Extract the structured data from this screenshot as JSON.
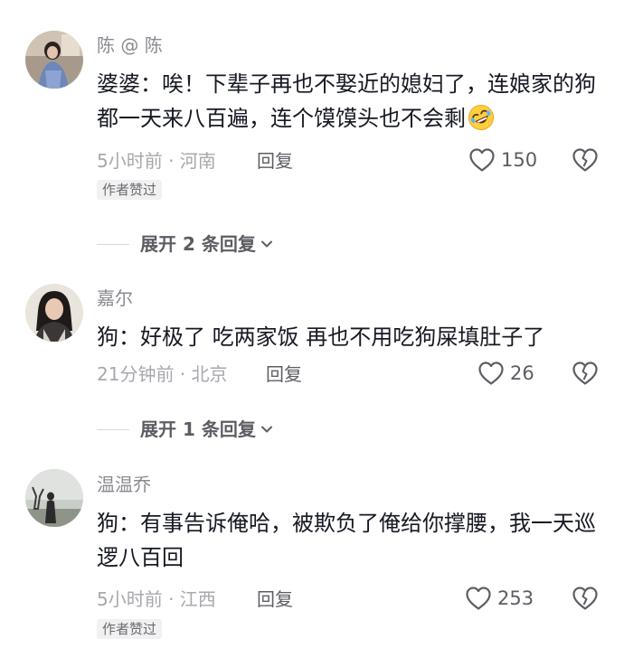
{
  "comments": [
    {
      "username": "陈 @ 陈",
      "text": "婆婆：唉！下辈子再也不娶近的媳妇了，连娘家的狗都一天来八百遍，连个馍馍头也不会剩",
      "emoji": "rolling-on-floor-laughing-emoji",
      "time_location": "5小时前 · 河南",
      "reply_label": "回复",
      "likes": "150",
      "badge": "作者赞过",
      "expand_label": "展开 2 条回复"
    },
    {
      "username": "嘉尔",
      "text": "狗：好极了 吃两家饭 再也不用吃狗屎填肚子了",
      "time_location": "21分钟前 · 北京",
      "reply_label": "回复",
      "likes": "26",
      "expand_label": "展开 1 条回复"
    },
    {
      "username": "温温乔",
      "text": "狗：有事告诉俺哈，被欺负了俺给你撑腰，我一天巡逻八百回",
      "time_location": "5小时前 · 江西",
      "reply_label": "回复",
      "likes": "253",
      "badge": "作者赞过"
    }
  ],
  "colors": {
    "text": "#161823",
    "muted": "#a7a8ad",
    "username": "#8a8b91",
    "badge_bg": "#f1f1f2"
  }
}
